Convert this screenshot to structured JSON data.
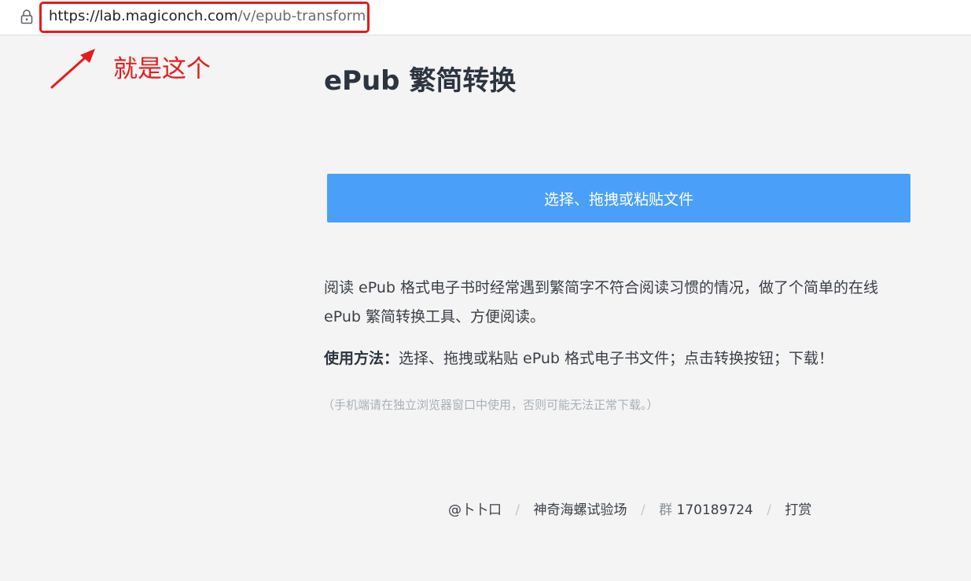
{
  "address_bar": {
    "url_host": "https://lab.magiconch.com",
    "url_path": "/v/epub-transform",
    "highlight_color": "#e31c1c"
  },
  "annotation": {
    "text": "就是这个",
    "color": "#e31c1c"
  },
  "page": {
    "title": "ePub 繁简转换",
    "upload_button_label": "选择、拖拽或粘贴文件",
    "button_color": "#4aa0f8",
    "intro": "阅读 ePub 格式电子书时经常遇到繁简字不符合阅读习惯的情况，做了个简单的在线 ePub 繁简转换工具、方便阅读。",
    "usage_label": "使用方法：",
    "usage_text": "选择、拖拽或粘贴 ePub 格式电子书文件；点击转换按钮；下载！",
    "note": "（手机端请在独立浏览器窗口中使用，否则可能无法正常下载。）"
  },
  "footer": {
    "author": "@卜卜口",
    "separator": "/",
    "site": "神奇海螺试验场",
    "group_prefix": "群",
    "group_number": "170189724",
    "donate": "打赏"
  }
}
